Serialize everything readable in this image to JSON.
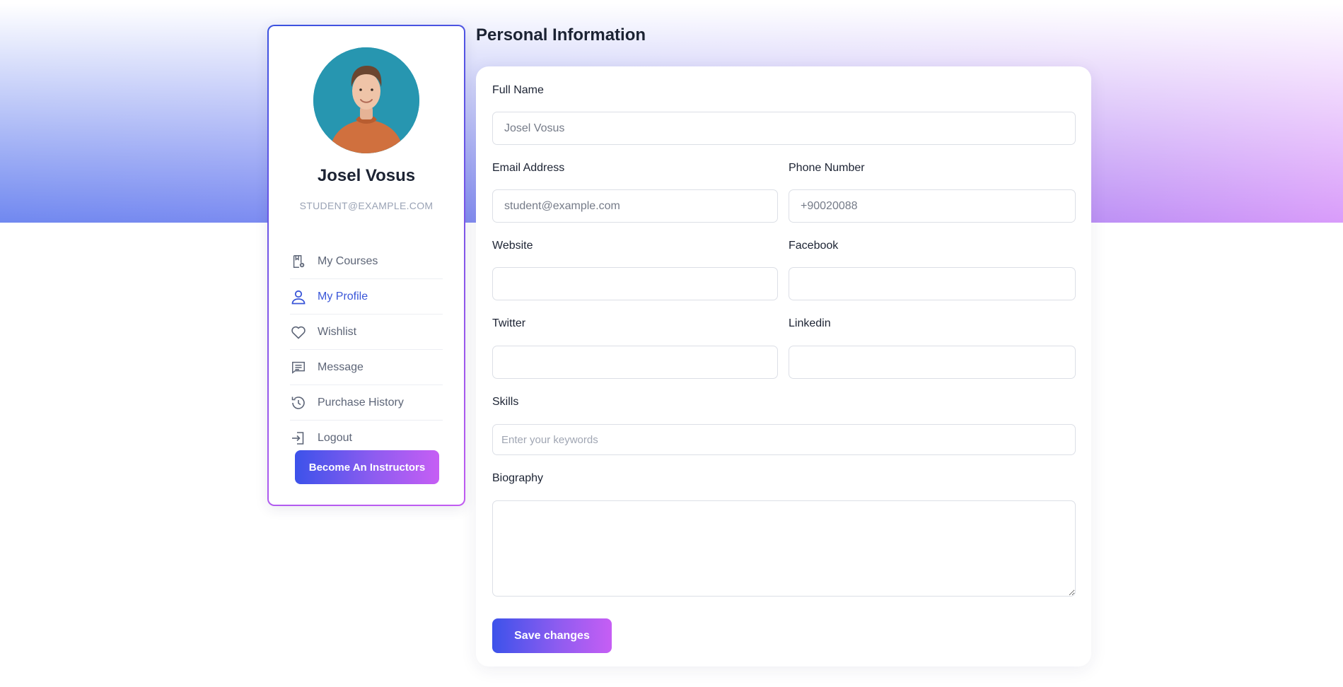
{
  "profile": {
    "name": "Josel Vosus",
    "email": "STUDENT@EXAMPLE.COM"
  },
  "menu": {
    "items": [
      {
        "label": "My Courses",
        "icon": "book-bookmark-icon"
      },
      {
        "label": "My Profile",
        "icon": "user-icon"
      },
      {
        "label": "Wishlist",
        "icon": "heart-icon"
      },
      {
        "label": "Message",
        "icon": "message-icon"
      },
      {
        "label": "Purchase History",
        "icon": "history-icon"
      },
      {
        "label": "Logout",
        "icon": "logout-icon"
      }
    ],
    "active": "My Profile"
  },
  "sidebar": {
    "become_label": "Become An Instructors"
  },
  "form": {
    "title": "Personal Information",
    "full_name_label": "Full Name",
    "full_name_placeholder": "Josel Vosus",
    "email_label": "Email Address",
    "email_placeholder": "student@example.com",
    "phone_label": "Phone Number",
    "phone_placeholder": "+90020088",
    "website_label": "Website",
    "facebook_label": "Facebook",
    "twitter_label": "Twitter",
    "linkedin_label": "Linkedin",
    "skills_label": "Skills",
    "skills_placeholder": "Enter your keywords",
    "bio_label": "Biography",
    "save_label": "Save changes"
  },
  "colors": {
    "accent": "#3a56d8",
    "gradient_start": "#3c52ea",
    "gradient_end": "#c65ef4"
  }
}
